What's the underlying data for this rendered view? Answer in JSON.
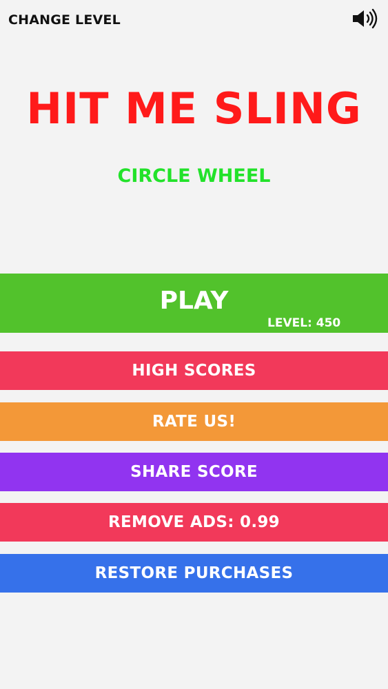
{
  "header": {
    "change_level_label": "CHANGE LEVEL",
    "sound_icon": "speaker-volume-icon"
  },
  "title": {
    "text": "HIT ME SLING",
    "color": "#ff1a1a"
  },
  "subtitle": {
    "text": "CIRCLE WHEEL",
    "color": "#22e22a"
  },
  "play": {
    "label": "PLAY",
    "level_text": "LEVEL: 450",
    "color": "#52c22c"
  },
  "menu": {
    "high_scores": {
      "label": "HIGH SCORES",
      "color": "#f2395a"
    },
    "rate_us": {
      "label": "RATE US!",
      "color": "#f39838"
    },
    "share_score": {
      "label": "SHARE SCORE",
      "color": "#9134f0"
    },
    "remove_ads": {
      "label": "REMOVE ADS: 0.99",
      "color": "#f2395a"
    },
    "restore_purchases": {
      "label": "RESTORE PURCHASES",
      "color": "#3671ea"
    }
  },
  "background": "#f3f3f3"
}
